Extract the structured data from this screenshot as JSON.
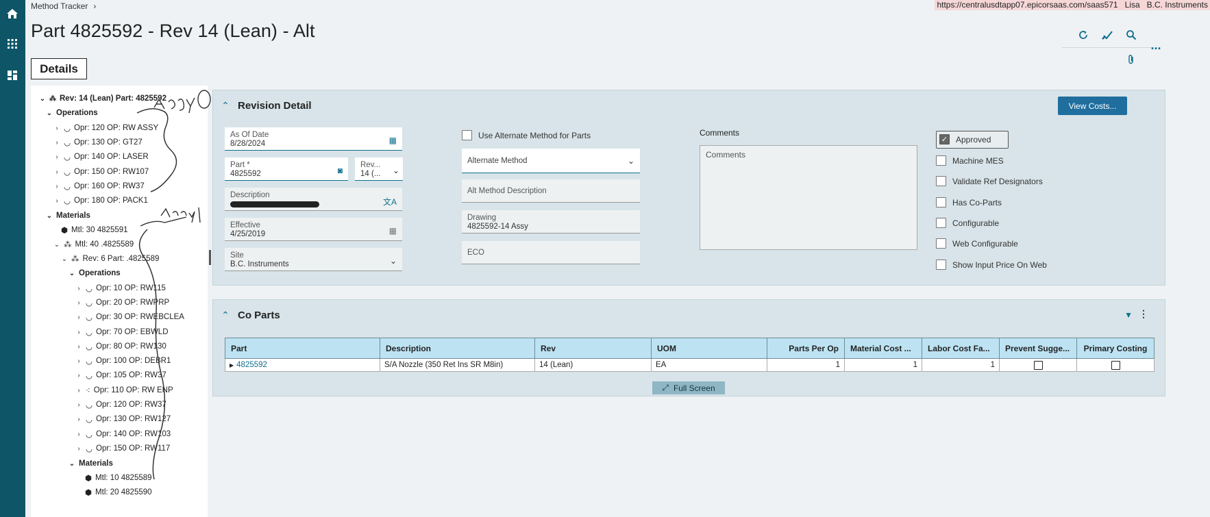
{
  "app": {
    "breadcrumb": [
      "Method Tracker",
      "›"
    ],
    "url": "https://centralusdtapp07.epicorsaas.com/saas571",
    "user": "Lisa",
    "company": "B.C. Instruments"
  },
  "page": {
    "title": "Part 4825592 - Rev 14 (Lean) - Alt",
    "details_tab": "Details"
  },
  "rail": {
    "icons": [
      "home-icon",
      "apps-grid-icon",
      "dashboard-icon"
    ]
  },
  "toolbar": {
    "icons": [
      "refresh-icon",
      "clear-icon",
      "search-icon",
      "more-icon",
      "attachment-icon"
    ],
    "more_label": "..."
  },
  "tree": {
    "root": "Rev: 14 (Lean) Part: 4825592",
    "operations_label": "Operations",
    "operations": [
      "Opr: 120 OP: RW ASSY",
      "Opr: 130 OP: GT27",
      "Opr: 140 OP: LASER",
      "Opr: 150 OP: RW107",
      "Opr: 160 OP: RW37",
      "Opr: 180 OP: PACK1"
    ],
    "materials_label": "Materials",
    "materials": [
      "Mtl: 30 4825591",
      "Mtl: 40 .4825589"
    ],
    "sub_rev": "Rev: 6 Part: .4825589",
    "sub_operations_label": "Operations",
    "sub_operations": [
      "Opr: 10 OP: RW115",
      "Opr: 20 OP: RWPRP",
      "Opr: 30 OP: RWEBCLEA",
      "Opr: 70 OP: EBWLD",
      "Opr: 80 OP: RW130",
      "Opr: 100 OP: DEBR1",
      "Opr: 105 OP: RW37",
      "Opr: 110 OP: RW ENP",
      "Opr: 120 OP: RW37",
      "Opr: 130 OP: RW127",
      "Opr: 140 OP: RW103",
      "Opr: 150 OP: RW117"
    ],
    "sub_materials_label": "Materials",
    "sub_materials": [
      "Mtl: 10 4825589",
      "Mtl: 20 4825590"
    ]
  },
  "revision_detail": {
    "title": "Revision Detail",
    "view_costs": "View Costs...",
    "as_of_date": {
      "label": "As Of Date",
      "value": "8/28/2024"
    },
    "part": {
      "label": "Part *",
      "value": "4825592"
    },
    "rev": {
      "label": "Rev...",
      "value": "14 (..."
    },
    "description": {
      "label": "Description",
      "value": ""
    },
    "effective": {
      "label": "Effective",
      "value": "4/25/2019"
    },
    "site": {
      "label": "Site",
      "value": "B.C. Instruments"
    },
    "use_alternate": {
      "label": "Use Alternate Method for Parts",
      "checked": false
    },
    "alternate_method": {
      "label": "Alternate Method"
    },
    "alt_method_description": {
      "label": "Alt Method Description"
    },
    "drawing": {
      "label": "Drawing",
      "value": "4825592-14 Assy"
    },
    "eco": {
      "label": "ECO"
    },
    "comments": {
      "label": "Comments",
      "placeholder": "Comments"
    },
    "flags": [
      {
        "label": "Approved",
        "checked": true
      },
      {
        "label": "Machine MES",
        "checked": false
      },
      {
        "label": "Validate Ref Designators",
        "checked": false
      },
      {
        "label": "Has Co-Parts",
        "checked": false
      },
      {
        "label": "Configurable",
        "checked": false
      },
      {
        "label": "Web Configurable",
        "checked": false
      },
      {
        "label": "Show Input Price On Web",
        "checked": false
      }
    ]
  },
  "co_parts": {
    "title": "Co Parts",
    "columns": [
      "Part",
      "Description",
      "Rev",
      "UOM",
      "Parts Per Op",
      "Material Cost ...",
      "Labor Cost Fa...",
      "Prevent Sugge...",
      "Primary Costing"
    ],
    "rows": [
      {
        "part": "4825592",
        "description": "S/A Nozzle (350 Ret Ins SR M8in)",
        "rev": "14 (Lean)",
        "uom": "EA",
        "parts_per_op": "1",
        "material_cost": "1",
        "labor_cost": "1",
        "prevent": false,
        "primary": false
      }
    ],
    "full_screen": "Full Screen"
  },
  "colors": {
    "rail": "#0e5568",
    "accent": "#0e6f8c",
    "primary_button": "#1f6e9e",
    "grid_header": "#bde3f3",
    "panel": "#d8e4e9"
  }
}
